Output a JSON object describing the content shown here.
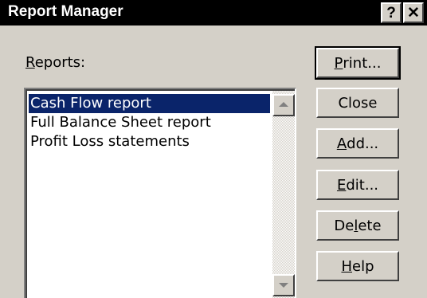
{
  "window": {
    "title": "Report Manager",
    "help_glyph": "?",
    "close_glyph": "✕"
  },
  "reports_label": {
    "accel": "R",
    "rest": "eports:"
  },
  "reports": [
    {
      "label": "Cash Flow report",
      "selected": true
    },
    {
      "label": "Full Balance Sheet report",
      "selected": false
    },
    {
      "label": "Profit Loss statements",
      "selected": false
    }
  ],
  "buttons": {
    "print": {
      "pre": "",
      "accel": "P",
      "post": "rint..."
    },
    "close": {
      "label": "Close"
    },
    "add": {
      "pre": "",
      "accel": "A",
      "post": "dd..."
    },
    "edit": {
      "pre": "",
      "accel": "E",
      "post": "dit..."
    },
    "delete": {
      "pre": "De",
      "accel": "l",
      "post": "ete"
    },
    "help": {
      "pre": "",
      "accel": "H",
      "post": "elp"
    }
  },
  "colors": {
    "face": "#d4d0c8",
    "titlebar": "#000000",
    "selection": "#0a246a"
  }
}
